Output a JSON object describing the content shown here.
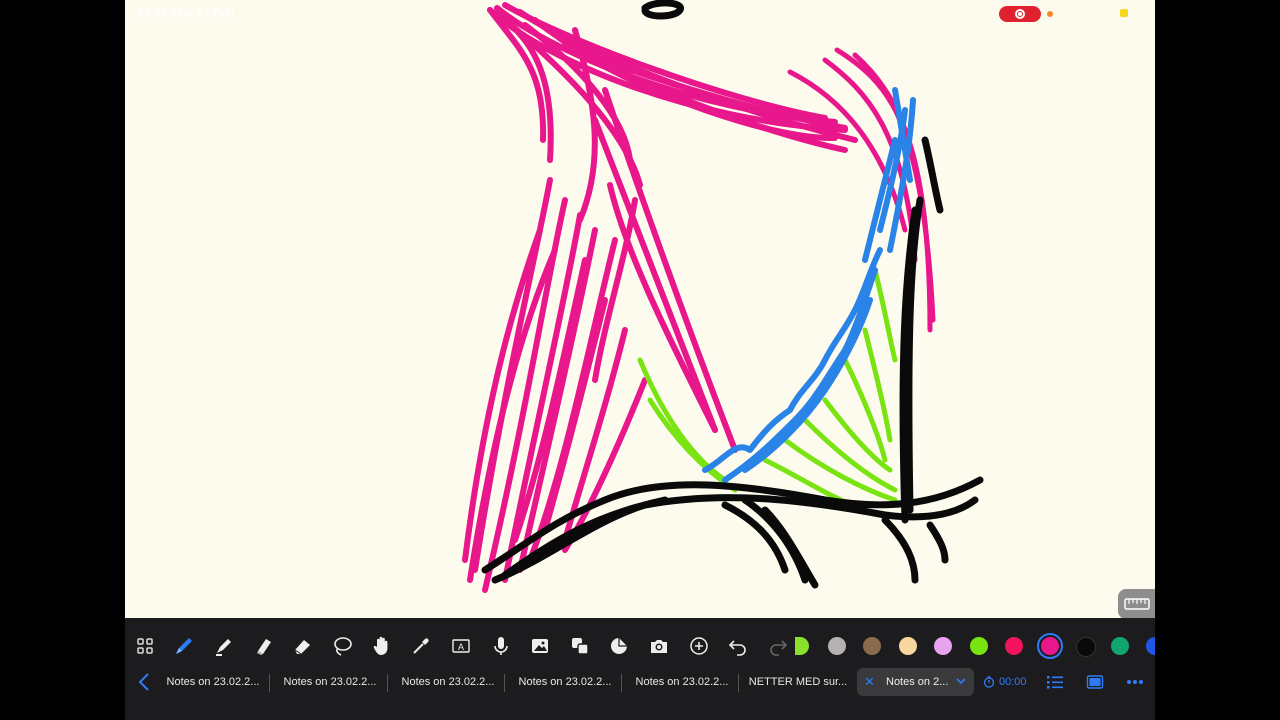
{
  "status_bar": {
    "time": "13:47 Thu 23 Feb"
  },
  "toolbar": {
    "tools": [
      "grid-view",
      "pen",
      "highlighter",
      "eraser-alt",
      "eraser",
      "lasso",
      "hand",
      "pipette",
      "text-box",
      "microphone",
      "image",
      "shapes",
      "sticker",
      "camera",
      "add",
      "undo",
      "redo"
    ],
    "colors": [
      "#8ae02a",
      "#b6b1b1",
      "#8a6b4e",
      "#f7d79e",
      "#e7a3f0",
      "#7ae312",
      "#f2145c",
      "#e8178c",
      "#0a0a0a",
      "#12a56f",
      "#1f56e8"
    ],
    "selected_color": "#e8178c"
  },
  "tabs": {
    "items": [
      {
        "label": "Notes on 23.02.2..."
      },
      {
        "label": "Notes on 23.02.2..."
      },
      {
        "label": "Notes on 23.02.2..."
      },
      {
        "label": "Notes on 23.02.2..."
      },
      {
        "label": "Notes on 23.02.2..."
      },
      {
        "label": "NETTER MED sur..."
      }
    ],
    "active": {
      "label": "Notes on 2..."
    },
    "timer": "00:00"
  }
}
